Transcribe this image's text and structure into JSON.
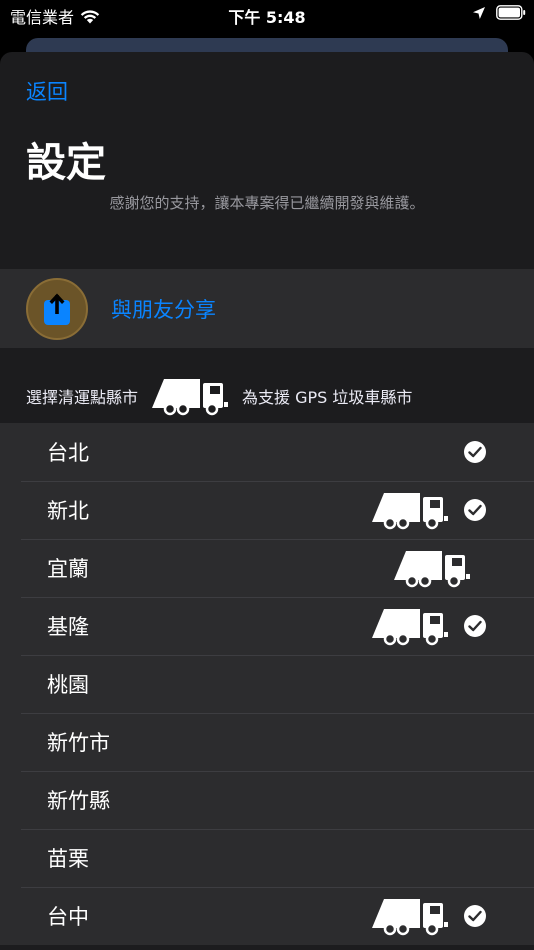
{
  "status_bar": {
    "carrier": "電信業者",
    "time": "下午 5:48"
  },
  "nav": {
    "back_label": "返回"
  },
  "page": {
    "title": "設定",
    "subtitle": "感謝您的支持，讓本專案得已繼續開發與維護。"
  },
  "share": {
    "label": "與朋友分享",
    "icon": "share-icon"
  },
  "section": {
    "left_text": "選擇清運點縣市",
    "right_text": "為支援 GPS 垃圾車縣市",
    "icon": "garbage-truck-icon"
  },
  "cities": [
    {
      "name": "台北",
      "gps": false,
      "checked": true
    },
    {
      "name": "新北",
      "gps": true,
      "checked": true
    },
    {
      "name": "宜蘭",
      "gps": true,
      "checked": false
    },
    {
      "name": "基隆",
      "gps": true,
      "checked": true
    },
    {
      "name": "桃園",
      "gps": false,
      "checked": false
    },
    {
      "name": "新竹市",
      "gps": false,
      "checked": false
    },
    {
      "name": "新竹縣",
      "gps": false,
      "checked": false
    },
    {
      "name": "苗栗",
      "gps": false,
      "checked": false
    },
    {
      "name": "台中",
      "gps": true,
      "checked": true
    }
  ],
  "colors": {
    "accent": "#0a84ff",
    "sheet": "#1c1c1e",
    "cell": "#2c2c2e"
  }
}
